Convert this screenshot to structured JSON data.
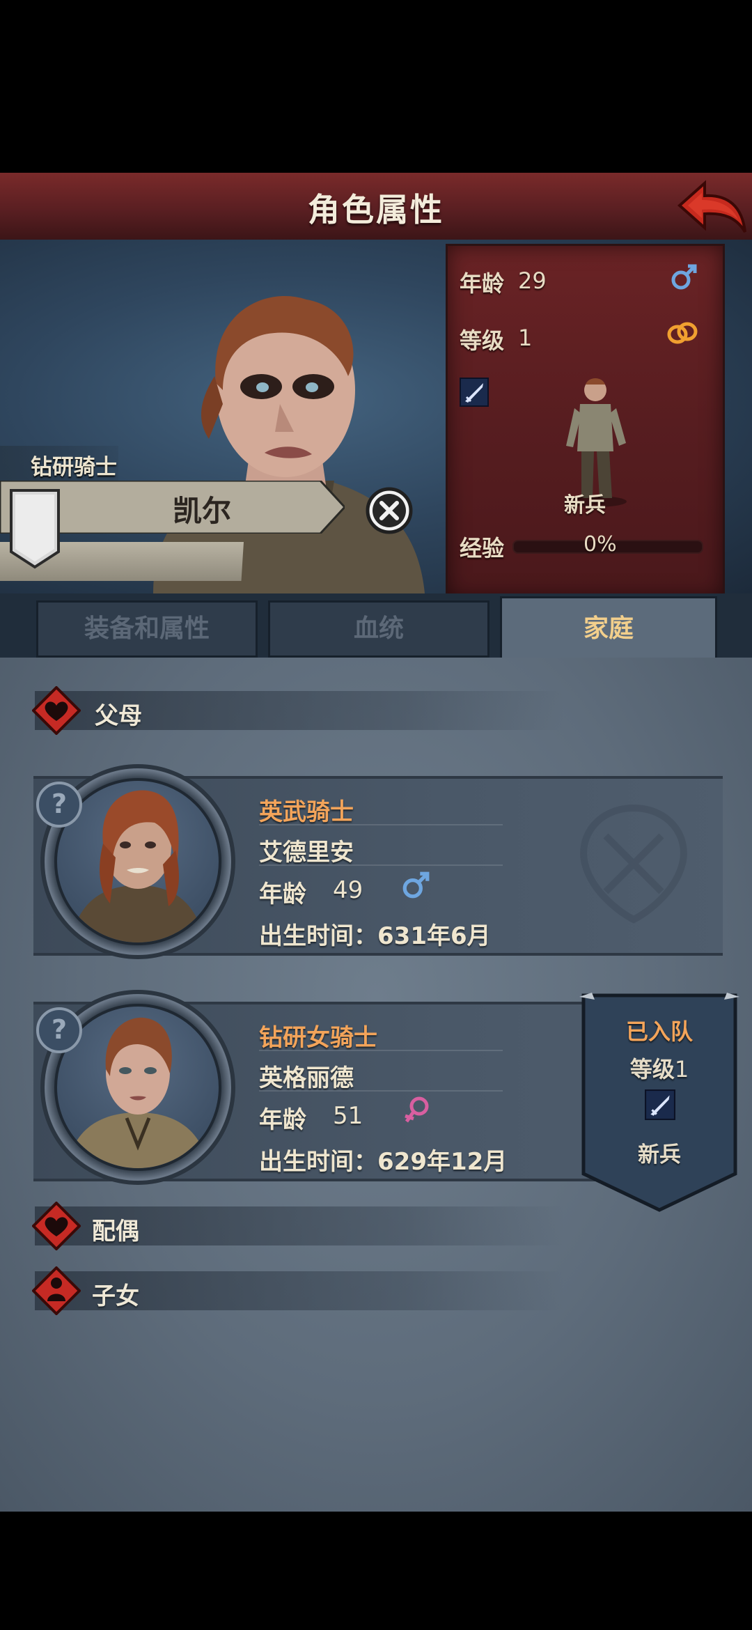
{
  "header": {
    "title": "角色属性",
    "back_icon": "back-arrow-icon"
  },
  "hero": {
    "class": "钻研骑士",
    "name": "凯尔",
    "stats": {
      "age_label": "年龄",
      "age": "29",
      "level_label": "等级",
      "level": "1",
      "gender_icon": "male-icon",
      "status_icon": "rings-icon",
      "weapon_icon": "sword-icon",
      "unit_label": "新兵",
      "exp_label": "经验",
      "exp_percent": "0%",
      "exp_fraction": 0
    }
  },
  "tabs": [
    {
      "label": "装备和属性",
      "active": false
    },
    {
      "label": "血统",
      "active": false
    },
    {
      "label": "家庭",
      "active": true
    }
  ],
  "family": {
    "parents_label": "父母",
    "spouse_label": "配偶",
    "children_label": "子女",
    "parents": [
      {
        "title": "英武骑士",
        "name": "艾德里安",
        "age_label": "年龄",
        "age": "49",
        "gender": "male",
        "birth": "出生时间：631年6月"
      },
      {
        "title": "钻研女骑士",
        "name": "英格丽德",
        "age_label": "年龄",
        "age": "51",
        "gender": "female",
        "birth": "出生时间：629年12月",
        "joined": {
          "status": "已入队",
          "level_label": "等级",
          "level": "1",
          "unit": "新兵"
        }
      }
    ]
  },
  "colors": {
    "header_red": "#6a2325",
    "accent_orange": "#f3a45a",
    "tab_active": "#f2cf8c",
    "male_blue": "#6ea6e0",
    "female_pink": "#d85fa0"
  }
}
